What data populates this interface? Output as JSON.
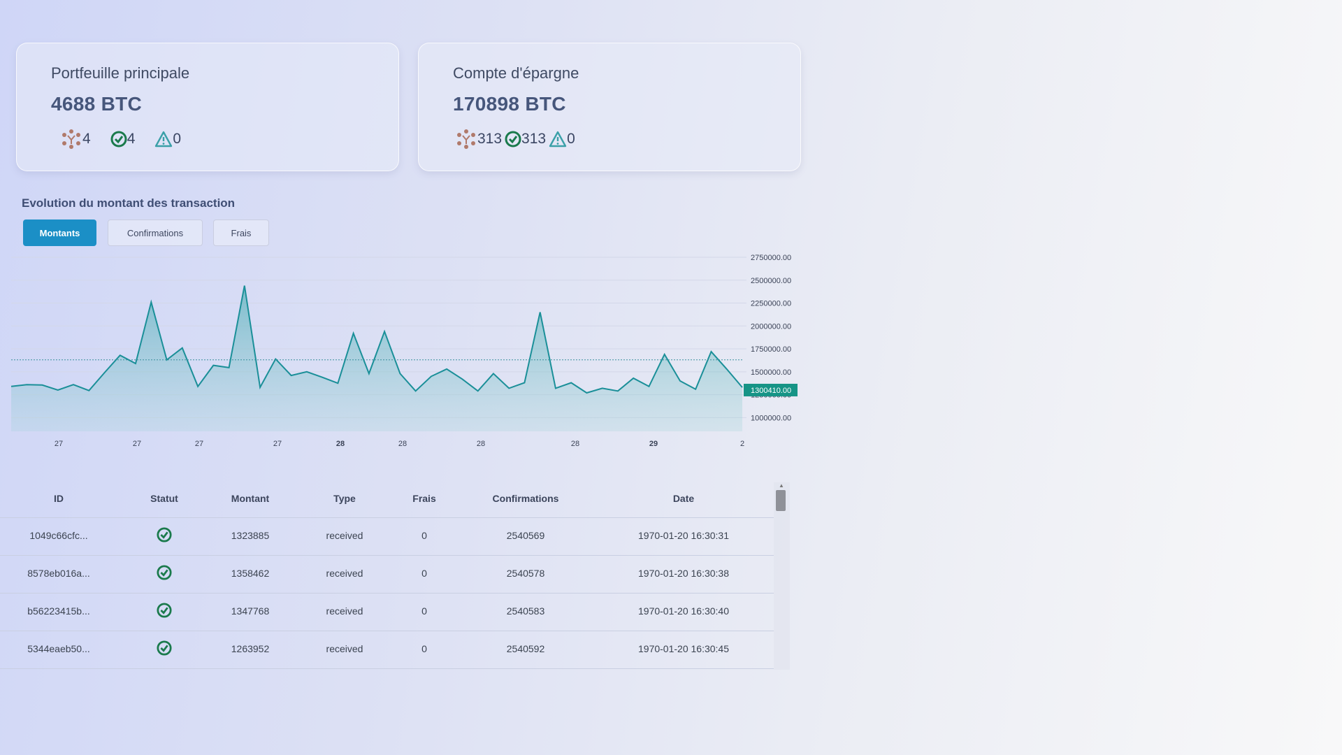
{
  "wallets": [
    {
      "title": "Portfeuille principale",
      "balance": "4688 BTC",
      "total": "4",
      "confirmed": "4",
      "warnings": "0"
    },
    {
      "title": "Compte d'épargne",
      "balance": "170898 BTC",
      "total": "313",
      "confirmed": "313",
      "warnings": "0"
    }
  ],
  "chart_section": {
    "title": "Evolution du montant des transaction",
    "tabs": [
      {
        "label": "Montants",
        "active": true
      },
      {
        "label": "Confirmations",
        "active": false
      },
      {
        "label": "Frais",
        "active": false
      }
    ]
  },
  "chart_data": {
    "type": "area",
    "y_ticks": [
      "2750000.00",
      "2500000.00",
      "2250000.00",
      "2000000.00",
      "1750000.00",
      "1500000.00",
      "1250000.00",
      "1000000.00"
    ],
    "y_range": [
      850000,
      2750000
    ],
    "x_tick_labels": [
      "27",
      "27",
      "27",
      "27",
      "28",
      "28",
      "28",
      "28",
      "29",
      "2"
    ],
    "current_value": "1300410.00",
    "average_line": 1630000,
    "values": [
      1340000,
      1360000,
      1355000,
      1300000,
      1360000,
      1295000,
      1490000,
      1680000,
      1590000,
      2260000,
      1630000,
      1760000,
      1340000,
      1570000,
      1545000,
      2440000,
      1330000,
      1640000,
      1460000,
      1500000,
      1440000,
      1375000,
      1920000,
      1480000,
      1940000,
      1480000,
      1290000,
      1450000,
      1530000,
      1420000,
      1290000,
      1480000,
      1320000,
      1380000,
      2150000,
      1320000,
      1380000,
      1270000,
      1320000,
      1290000,
      1430000,
      1340000,
      1690000,
      1400000,
      1310000,
      1720000,
      1530000,
      1330000
    ],
    "color": "#1a8f98"
  },
  "table": {
    "columns": [
      "ID",
      "Statut",
      "Montant",
      "Type",
      "Frais",
      "Confirmations",
      "Date"
    ],
    "rows": [
      {
        "id": "1049c66cfc...",
        "status": "confirmed",
        "montant": "1323885",
        "type": "received",
        "frais": "0",
        "confirmations": "2540569",
        "date": "1970-01-20 16:30:31"
      },
      {
        "id": "8578eb016a...",
        "status": "confirmed",
        "montant": "1358462",
        "type": "received",
        "frais": "0",
        "confirmations": "2540578",
        "date": "1970-01-20 16:30:38"
      },
      {
        "id": "b56223415b...",
        "status": "confirmed",
        "montant": "1347768",
        "type": "received",
        "frais": "0",
        "confirmations": "2540583",
        "date": "1970-01-20 16:30:40"
      },
      {
        "id": "5344eaeb50...",
        "status": "confirmed",
        "montant": "1263952",
        "type": "received",
        "frais": "0",
        "confirmations": "2540592",
        "date": "1970-01-20 16:30:45"
      }
    ]
  },
  "icons": {
    "total": "pending-dots-icon",
    "confirmed": "check-circle-icon",
    "warning": "warning-triangle-icon"
  },
  "colors": {
    "accent": "#1b8fc6",
    "check": "#1a7a4c",
    "warning": "#3aa0a8",
    "pending": "#b07a6b"
  }
}
